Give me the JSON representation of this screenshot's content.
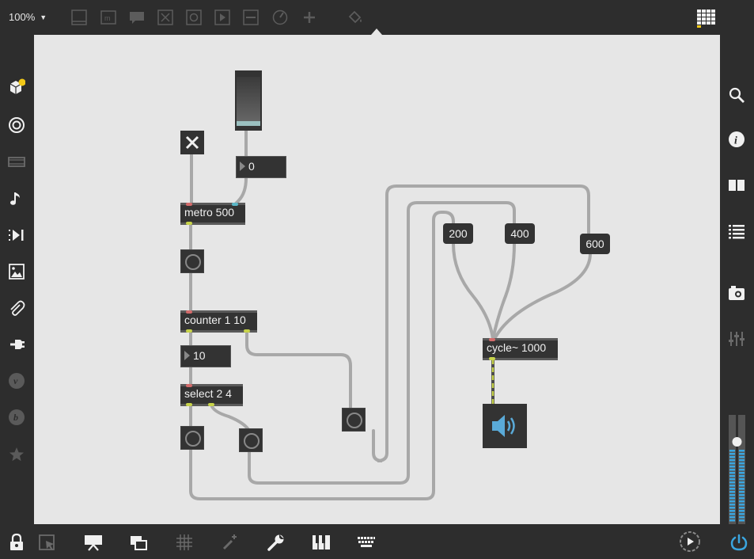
{
  "toolbar": {
    "zoom": "100%",
    "icons": [
      "presentation-icon",
      "comment-icon",
      "message-icon",
      "toggle-icon",
      "bang-icon",
      "playbar-icon",
      "slider-icon",
      "dial-icon",
      "add-icon",
      "paint-bucket-icon",
      "grid-menu-icon"
    ]
  },
  "patch": {
    "metro_label": "metro 500",
    "counter_label": "counter 1 10",
    "select_label": "select 2 4",
    "cycle_label": "cycle~ 1000",
    "number1_value": "0",
    "number2_value": "10",
    "msg_200": "200",
    "msg_400": "400",
    "msg_600": "600"
  },
  "left_sidebar": [
    "package-icon",
    "target-icon",
    "video-icon",
    "music-note-icon",
    "media-step-icon",
    "image-icon",
    "paperclip-icon",
    "plug-icon",
    "vimeo-icon",
    "bandcamp-icon",
    "star-icon"
  ],
  "right_sidebar": [
    "search-icon",
    "info-icon",
    "book-icon",
    "list-icon",
    "camera-icon",
    "mixer-icon"
  ],
  "bottom_bar": [
    "lock-icon",
    "select-cursor-icon",
    "presentation-mode-icon",
    "windows-icon",
    "grid-icon",
    "wand-icon",
    "wrench-icon",
    "piano-icon",
    "keyboard-icon",
    "transport-icon",
    "power-icon"
  ],
  "colors": {
    "canvas": "#e6e6e6",
    "chrome": "#2d2d2d",
    "object": "#333333",
    "accent_blue": "#3aa6e0",
    "yellow_badge": "#f2c918"
  }
}
